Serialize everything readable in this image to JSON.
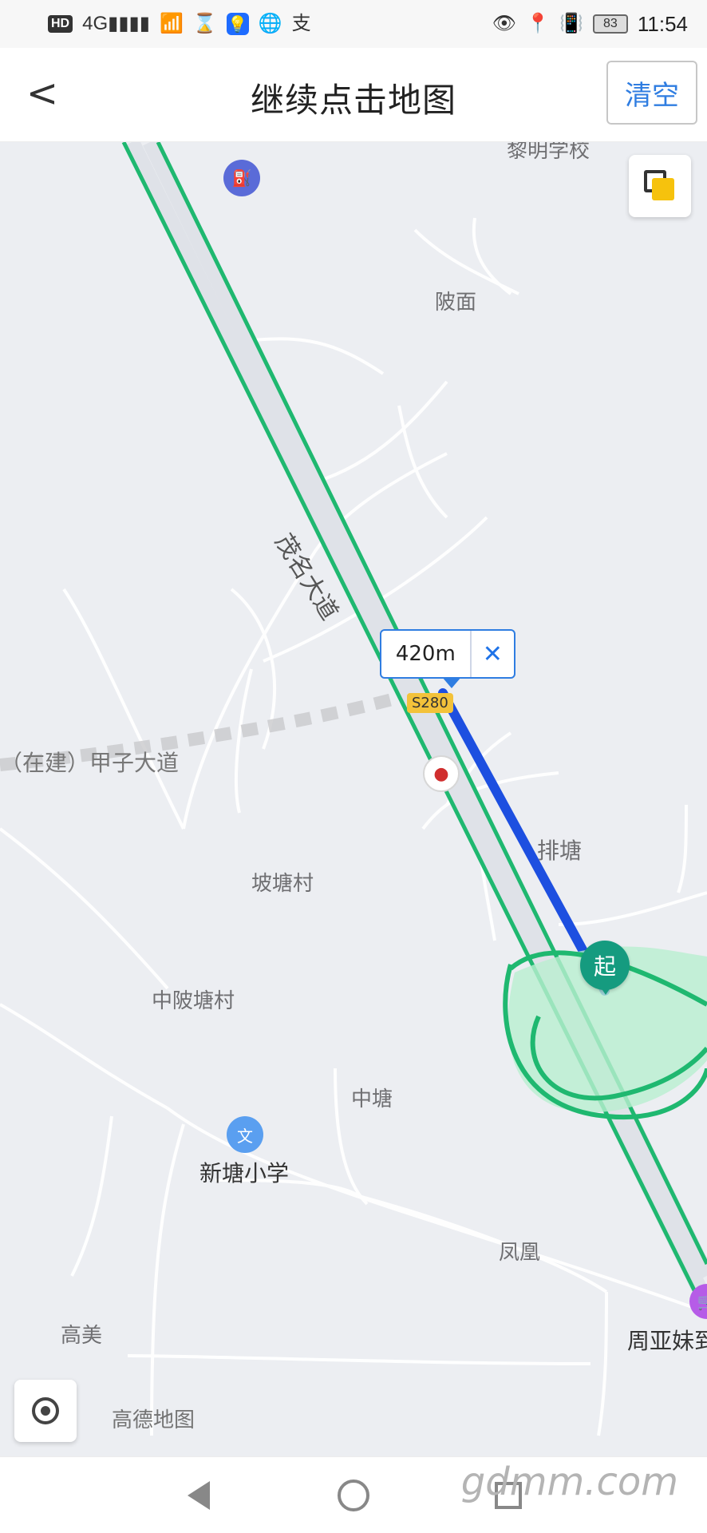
{
  "status_bar": {
    "left_icons": [
      "hd-icon",
      "signal-4g-icon",
      "wifi-icon",
      "hourglass-icon",
      "lightbulb-icon",
      "globe-icon",
      "alipay-icon"
    ],
    "hd_label": "HD",
    "network_label": "4G",
    "battery_level": "83",
    "time": "11:54"
  },
  "header": {
    "title": "继续点击地图",
    "back_label": "<",
    "clear_label": "清空"
  },
  "map": {
    "labels": {
      "top_school": "黎明学校",
      "shan_mian": "陂面",
      "mao_ming_road": "茂名大道",
      "under_construction_road": "（在建）甲子大道",
      "pai_tang": "排塘",
      "po_tang_cun": "坡塘村",
      "zhong_pi_tang_cun": "中陂塘村",
      "zhong_tang": "中塘",
      "xin_tang_xiao_xue": "新塘小学",
      "feng_huang": "凤凰",
      "gao_mei": "高美",
      "zhou_ya_mei": "周亚妹到",
      "highway": "S280"
    },
    "distance_callout": {
      "distance": "420m",
      "close_label": "✕"
    },
    "markers": {
      "start": "起"
    },
    "watermark": "高德地图"
  },
  "navbar": {
    "back_icon": "back-triangle-icon",
    "home_icon": "home-circle-icon",
    "recent_icon": "recent-square-icon"
  },
  "watermark_site": "gdmm.com"
}
